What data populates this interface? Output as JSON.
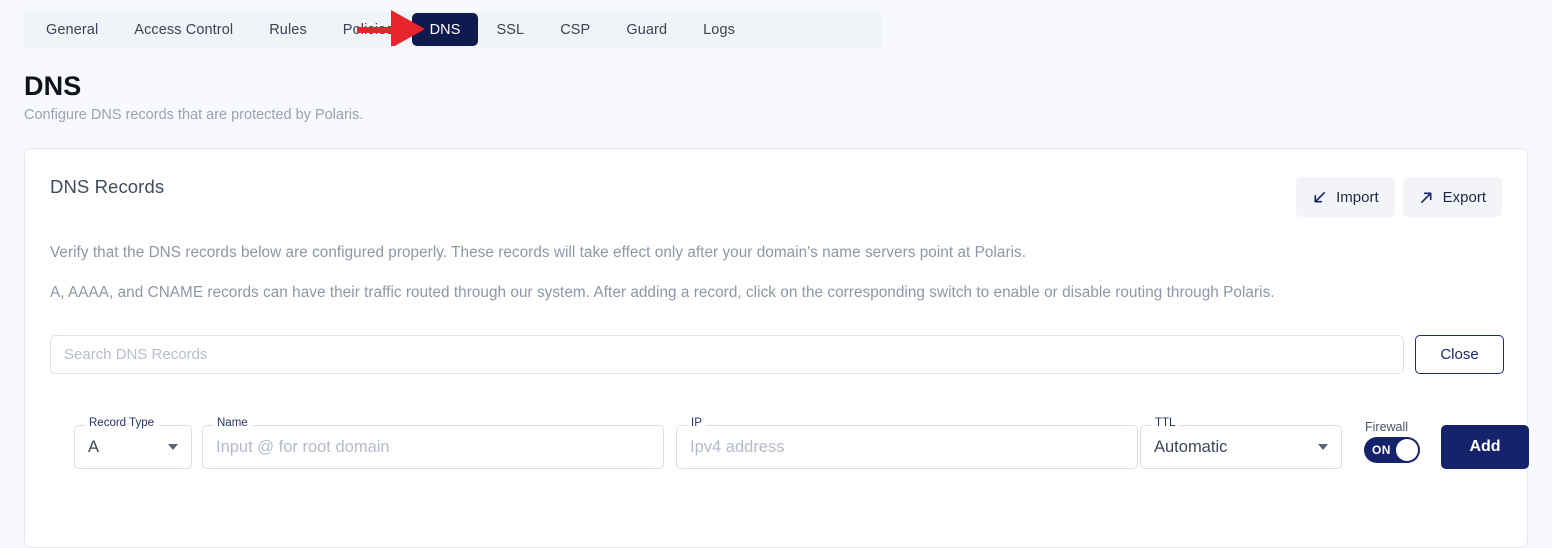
{
  "tabs": [
    {
      "label": "General",
      "active": false
    },
    {
      "label": "Access Control",
      "active": false
    },
    {
      "label": "Rules",
      "active": false
    },
    {
      "label": "Policies",
      "active": false
    },
    {
      "label": "DNS",
      "active": true
    },
    {
      "label": "SSL",
      "active": false
    },
    {
      "label": "CSP",
      "active": false
    },
    {
      "label": "Guard",
      "active": false
    },
    {
      "label": "Logs",
      "active": false
    }
  ],
  "page": {
    "title": "DNS",
    "subtitle": "Configure DNS records that are protected by Polaris."
  },
  "card": {
    "heading": "DNS Records",
    "import_label": "Import",
    "export_label": "Export",
    "paragraph_1": "Verify that the DNS records below are configured properly. These records will take effect only after your domain's name servers point at Polaris.",
    "paragraph_2": "A, AAAA, and CNAME records can have their traffic routed through our system. After adding a record, click on the corresponding switch to enable or disable routing through Polaris."
  },
  "search": {
    "value": "",
    "placeholder": "Search DNS Records",
    "close_label": "Close"
  },
  "form": {
    "record_type": {
      "label": "Record Type",
      "value": "A"
    },
    "name": {
      "label": "Name",
      "value": "",
      "placeholder": "Input @ for root domain"
    },
    "ip": {
      "label": "IP",
      "value": "",
      "placeholder": "Ipv4 address"
    },
    "ttl": {
      "label": "TTL",
      "value": "Automatic"
    },
    "firewall": {
      "label": "Firewall",
      "state": "ON"
    },
    "add_label": "Add"
  },
  "annotation": {
    "arrow_color": "#e8232a",
    "points_to": "DNS"
  },
  "colors": {
    "accent_navy": "#14236b",
    "active_tab": "#0f1a4f",
    "page_bg": "#f7f9fc",
    "muted_text": "#8c97a8"
  }
}
